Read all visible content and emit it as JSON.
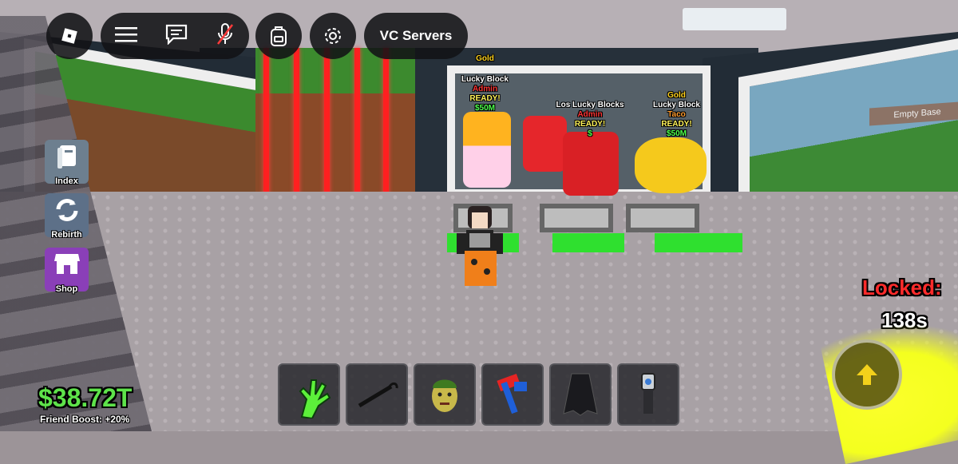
{
  "topbar": {
    "roblox_icon": "roblox-logo-icon",
    "menu_icon": "hamburger-menu-icon",
    "chat_icon": "chat-icon",
    "mic_icon": "microphone-muted-icon",
    "backpack_icon": "backpack-icon",
    "settings_icon": "gear-icon",
    "vc_servers_label": "VC Servers"
  },
  "side_menu": {
    "index_label": "Index",
    "rebirth_label": "Rebirth",
    "shop_label": "Shop"
  },
  "stats": {
    "money": "$38.72T",
    "friend_boost": "Friend Boost: +20%",
    "locked_label": "Locked:",
    "locked_time": "138s"
  },
  "billboards": [
    {
      "rarity": "Gold",
      "name": "Lucky Block",
      "mutation": "Admin",
      "status": "READY!",
      "price": "$50M"
    },
    {
      "rarity": "",
      "name": "Los Lucky Blocks",
      "mutation": "Admin",
      "status": "READY!",
      "price": "$"
    },
    {
      "rarity": "Gold",
      "name": "Lucky Block",
      "mutation": "Taco",
      "status": "READY!",
      "price": "$50M"
    }
  ],
  "background_sign": "Empty Base",
  "hotbar": {
    "slots": [
      {
        "icon": "green-slap-hand-icon"
      },
      {
        "icon": "grapple-hook-icon"
      },
      {
        "icon": "medusa-head-icon"
      },
      {
        "icon": "red-blue-hammer-icon"
      },
      {
        "icon": "dark-cape-icon"
      },
      {
        "icon": "flashlight-gadget-icon"
      }
    ]
  },
  "colors": {
    "money_green": "#5ee34a",
    "locked_red": "#ff2b2b",
    "jump_yellow": "#f4ff1f",
    "shop_purple": "#8a3fb8"
  }
}
